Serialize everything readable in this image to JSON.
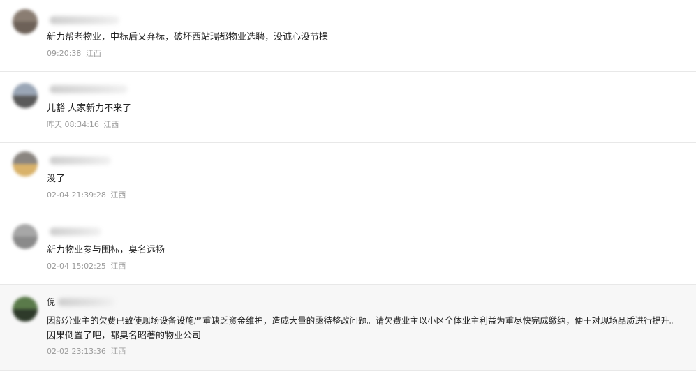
{
  "comments": [
    {
      "username_visible": "",
      "text_lines": [
        "新力帮老物业，中标后又弃标，破坏西站瑞都物业选聘，没诚心没节操"
      ],
      "time": "09:20:38",
      "location": "江西",
      "avatar_colors": [
        "#8a7d72",
        "#6d6158"
      ]
    },
    {
      "username_visible": "",
      "text_lines": [
        "儿豁  人家新力不来了"
      ],
      "time": "昨天 08:34:16",
      "location": "江西",
      "avatar_colors": [
        "#9aa6b6",
        "#5a5a5a"
      ]
    },
    {
      "username_visible": "",
      "text_lines": [
        "没了"
      ],
      "time": "02-04 21:39:28",
      "location": "江西",
      "avatar_colors": [
        "#8a8580",
        "#d9b26a"
      ]
    },
    {
      "username_visible": "",
      "text_lines": [
        "新力物业参与围标，臭名远扬"
      ],
      "time": "02-04 15:02:25",
      "location": "江西",
      "avatar_colors": [
        "#a7a7a7",
        "#8a8a8a"
      ]
    },
    {
      "username_visible": "倪",
      "text_lines": [
        "因部分业主的欠费已致使现场设备设施严重缺乏资金维护，造成大量的亟待整改问题。请欠费业主以小区全体业主利益为重尽快完成缴纳，便于对现场品质进行提升。",
        "因果倒置了吧，都臭名昭著的物业公司"
      ],
      "time": "02-02 23:13:36",
      "location": "江西",
      "avatar_colors": [
        "#5a7a4a",
        "#2e3a2a"
      ]
    }
  ]
}
